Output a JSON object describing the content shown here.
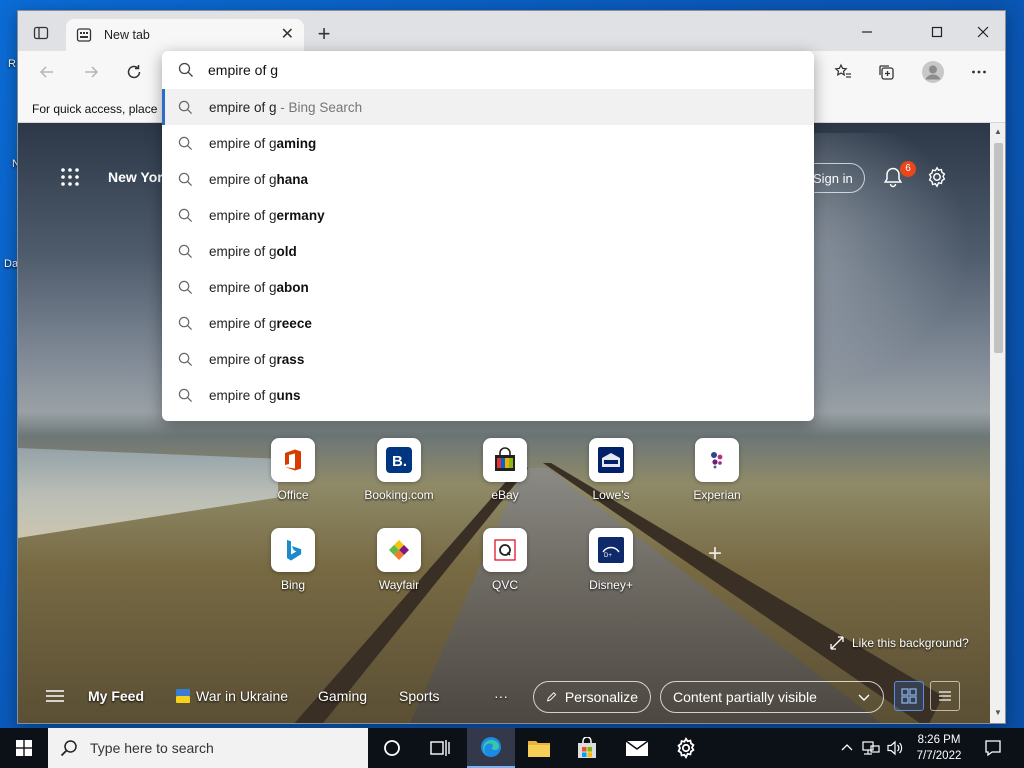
{
  "desktop": {
    "frag_r": "R",
    "frag_n": "N",
    "frag_da": "Da"
  },
  "browser": {
    "tab": {
      "title": "New tab",
      "close_glyph": "✕"
    },
    "new_tab_glyph": "+",
    "favorites_bar_text": "For quick access, place y",
    "omnibox": {
      "input_value": "empire of g",
      "suggestions": [
        {
          "prefix": "empire of g",
          "bold": "",
          "hint": " - Bing Search"
        },
        {
          "prefix": "empire of g",
          "bold": "aming",
          "hint": ""
        },
        {
          "prefix": "empire of g",
          "bold": "hana",
          "hint": ""
        },
        {
          "prefix": "empire of g",
          "bold": "ermany",
          "hint": ""
        },
        {
          "prefix": "empire of g",
          "bold": "old",
          "hint": ""
        },
        {
          "prefix": "empire of g",
          "bold": "abon",
          "hint": ""
        },
        {
          "prefix": "empire of g",
          "bold": "reece",
          "hint": ""
        },
        {
          "prefix": "empire of g",
          "bold": "rass",
          "hint": ""
        },
        {
          "prefix": "empire of g",
          "bold": "uns",
          "hint": ""
        }
      ]
    }
  },
  "ntp": {
    "weather_location": "New York",
    "signin_label": "Sign in",
    "notification_count": "6",
    "tiles": [
      {
        "label": "Office"
      },
      {
        "label": "Booking.com"
      },
      {
        "label": "eBay"
      },
      {
        "label": "Lowe's"
      },
      {
        "label": "Experian"
      },
      {
        "label": "Bing"
      },
      {
        "label": "Wayfair"
      },
      {
        "label": "QVC"
      },
      {
        "label": "Disney+"
      }
    ],
    "add_tile_glyph": "+",
    "like_background": "Like this background?",
    "feed": {
      "my_feed": "My Feed",
      "war_in_ukraine": "War in Ukraine",
      "gaming": "Gaming",
      "sports": "Sports",
      "more": "···",
      "personalize": "Personalize",
      "content_visibility": "Content partially visible"
    }
  },
  "taskbar": {
    "search_placeholder": "Type here to search",
    "time": "8:26 PM",
    "date": "7/7/2022"
  },
  "colors": {
    "accent": "#2e6bc6",
    "badge": "#e8461b",
    "taskbar": "#0c1017"
  }
}
